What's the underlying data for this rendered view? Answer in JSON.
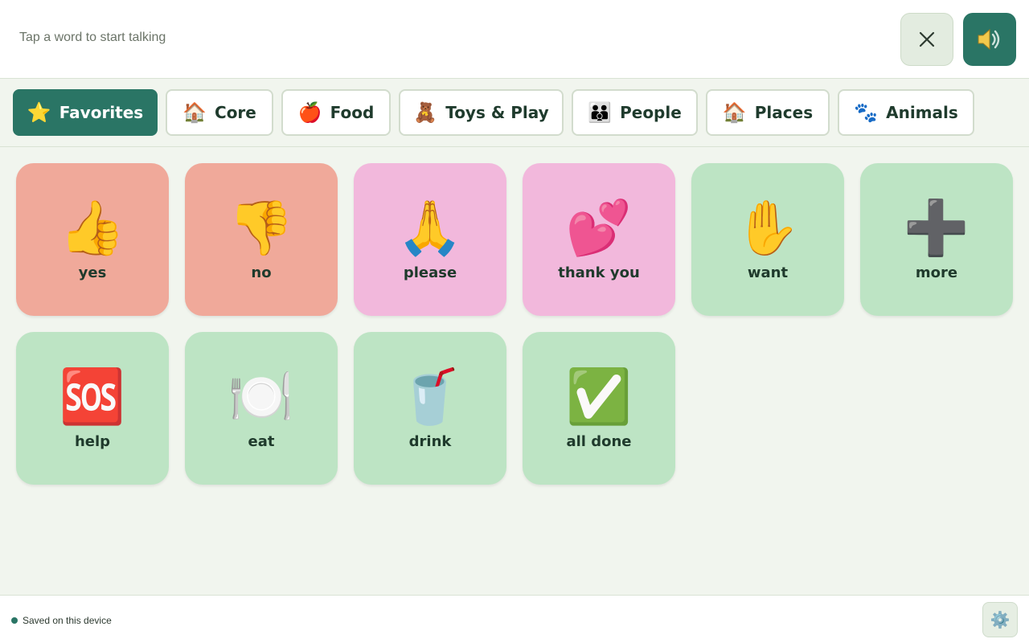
{
  "header": {
    "sentence_placeholder": "Tap a word to start talking",
    "clear_icon": "close-icon",
    "speak_icon": "speaker-icon"
  },
  "tabs": [
    {
      "emoji": "⭐",
      "label": "Favorites",
      "active": true
    },
    {
      "emoji": "🏠",
      "label": "Core"
    },
    {
      "emoji": "🍎",
      "label": "Food"
    },
    {
      "emoji": "🧸",
      "label": "Toys & Play"
    },
    {
      "emoji": "👪",
      "label": "People"
    },
    {
      "emoji": "🏠",
      "label": "Places"
    },
    {
      "emoji": "🐾",
      "label": "Animals"
    }
  ],
  "tiles": [
    {
      "emoji": "👍",
      "word": "yes",
      "color": "#f0a99a"
    },
    {
      "emoji": "👎",
      "word": "no",
      "color": "#f0a99a"
    },
    {
      "emoji": "🙏",
      "word": "please",
      "color": "#f2b8dc"
    },
    {
      "emoji": "💕",
      "word": "thank you",
      "color": "#f2b8dc"
    },
    {
      "emoji": "✋",
      "word": "want",
      "color": "#bde4c4"
    },
    {
      "emoji": "➕",
      "word": "more",
      "color": "#bde4c4"
    },
    {
      "emoji": "🆘",
      "word": "help",
      "color": "#bde4c4"
    },
    {
      "emoji": "🍽️",
      "word": "eat",
      "color": "#bde4c4"
    },
    {
      "emoji": "🥤",
      "word": "drink",
      "color": "#bde4c4"
    },
    {
      "emoji": "✅",
      "word": "all done",
      "color": "#bde4c4"
    }
  ],
  "footer": {
    "status_text": "Saved on this device",
    "settings_icon": "⚙️"
  },
  "colors": {
    "accent": "#2a7565",
    "background": "#f1f5ee"
  }
}
